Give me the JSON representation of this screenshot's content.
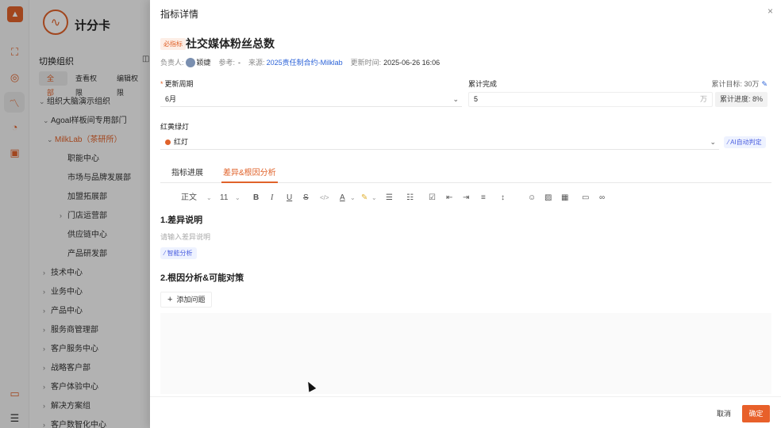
{
  "app": {
    "name": "计分卡"
  },
  "sidebar": {
    "switch_title": "切换组织",
    "perm_tabs": [
      "全部",
      "查看权限",
      "编辑权限"
    ],
    "tree": [
      {
        "label": "组织大脑演示组织",
        "level": 0,
        "expand": "open"
      },
      {
        "label": "Agoal样板间专用部门",
        "level": 1,
        "expand": "open"
      },
      {
        "label": "MilkLab（茶研所）",
        "level": 2,
        "expand": "open",
        "selected": true
      },
      {
        "label": "职能中心",
        "level": 3,
        "expand": "none"
      },
      {
        "label": "市场与品牌发展部",
        "level": 3,
        "expand": "none"
      },
      {
        "label": "加盟拓展部",
        "level": 3,
        "expand": "none"
      },
      {
        "label": "门店运营部",
        "level": 3,
        "expand": "closed"
      },
      {
        "label": "供应链中心",
        "level": 3,
        "expand": "none"
      },
      {
        "label": "产品研发部",
        "level": 3,
        "expand": "none"
      },
      {
        "label": "技术中心",
        "level": 1,
        "expand": "closed"
      },
      {
        "label": "业务中心",
        "level": 1,
        "expand": "closed"
      },
      {
        "label": "产品中心",
        "level": 1,
        "expand": "closed"
      },
      {
        "label": "服务商管理部",
        "level": 1,
        "expand": "closed"
      },
      {
        "label": "客户服务中心",
        "level": 1,
        "expand": "closed"
      },
      {
        "label": "战略客户部",
        "level": 1,
        "expand": "closed"
      },
      {
        "label": "客户体验中心",
        "level": 1,
        "expand": "closed"
      },
      {
        "label": "解决方案组",
        "level": 1,
        "expand": "closed"
      },
      {
        "label": "客户数智化中心",
        "level": 1,
        "expand": "closed"
      }
    ]
  },
  "drawer": {
    "title": "指标详情",
    "close_label": "×",
    "badge": "必指标",
    "kpi_title": "社交媒体粉丝总数",
    "meta": {
      "owner_label": "负责人:",
      "owner_name": "颖婕",
      "ref_label": "参考:",
      "ref_value": "-",
      "source_label": "来源:",
      "source_value": "2025责任制合约-Milklab",
      "updated_label": "更新时间:",
      "updated_value": "2025-06-26 16:06"
    },
    "period": {
      "label": "更新周期",
      "value": "6月"
    },
    "cumulative": {
      "label": "累计完成",
      "value": "5",
      "unit": "万",
      "target": "累计目标: 30万",
      "progress": "累计进度: 8%"
    },
    "light": {
      "label": "红黄绿灯",
      "value": "红灯",
      "ai_label": "AI自动判定"
    },
    "tabs": [
      "指标进展",
      "差异&根因分析"
    ],
    "active_tab": 1,
    "toolbar": {
      "paragraph": "正文",
      "font_size": "11",
      "icons": [
        "bold-icon",
        "italic-icon",
        "underline-icon",
        "strikethrough-icon",
        "code-icon",
        "font-color-icon",
        "highlight-icon",
        "bullet-list-icon",
        "ordered-list-icon",
        "task-list-icon",
        "outdent-icon",
        "indent-icon",
        "align-icon",
        "line-height-icon",
        "emoji-icon",
        "image-icon",
        "table-icon",
        "folder-icon",
        "link-icon"
      ]
    },
    "section1": {
      "heading": "1.差异说明",
      "placeholder": "请输入差异说明",
      "ai_label": "智能分析"
    },
    "section2": {
      "heading": "2.根因分析&可能对策",
      "add_label": "添加问题"
    },
    "footer": {
      "cancel": "取消",
      "ok": "确定"
    }
  }
}
